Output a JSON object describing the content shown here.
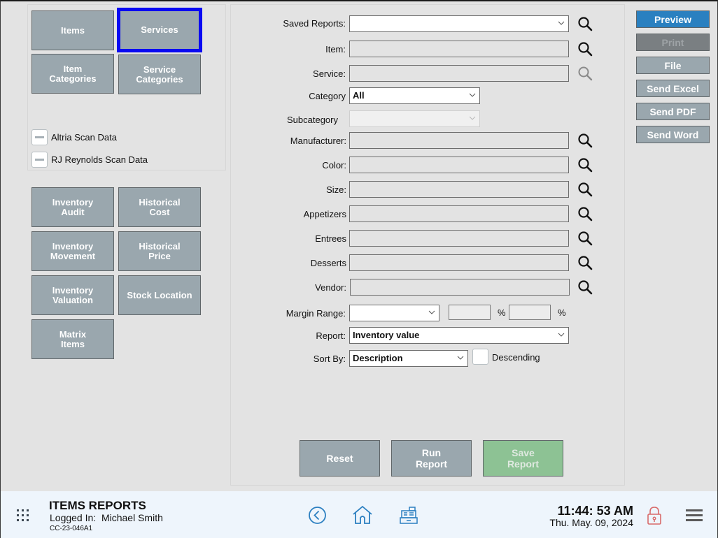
{
  "left_panel": {
    "report_types": [
      {
        "label": "Items",
        "selected": false
      },
      {
        "label": "Services",
        "selected": true
      },
      {
        "label": "Item\nCategories",
        "selected": false
      },
      {
        "label": "Service\nCategories",
        "selected": false
      }
    ],
    "scan_data": [
      {
        "label": "Altria Scan Data"
      },
      {
        "label": "RJ Reynolds Scan Data"
      }
    ],
    "other_reports": [
      {
        "label": "Inventory\nAudit"
      },
      {
        "label": "Historical\nCost"
      },
      {
        "label": "Inventory\nMovement"
      },
      {
        "label": "Historical\nPrice"
      },
      {
        "label": "Inventory\nValuation"
      },
      {
        "label": "Stock Location"
      },
      {
        "label": "Matrix\nItems"
      }
    ]
  },
  "form": {
    "saved_reports": {
      "label": "Saved Reports:",
      "value": ""
    },
    "item": {
      "label": "Item:",
      "value": ""
    },
    "service": {
      "label": "Service:",
      "value": ""
    },
    "category": {
      "label": "Category",
      "value": "All"
    },
    "subcategory": {
      "label": "Subcategory",
      "value": ""
    },
    "manufacturer": {
      "label": "Manufacturer:",
      "value": ""
    },
    "color": {
      "label": "Color:",
      "value": ""
    },
    "size": {
      "label": "Size:",
      "value": ""
    },
    "appetizers": {
      "label": "Appetizers",
      "value": ""
    },
    "entrees": {
      "label": "Entrees",
      "value": ""
    },
    "desserts": {
      "label": "Desserts",
      "value": ""
    },
    "vendor": {
      "label": "Vendor:",
      "value": ""
    },
    "margin_range": {
      "label": "Margin Range:",
      "value": "",
      "from": "",
      "to": "",
      "unit": "%"
    },
    "report": {
      "label": "Report:",
      "value": "Inventory value"
    },
    "sort_by": {
      "label": "Sort By:",
      "value": "Description",
      "descending_label": "Descending",
      "descending": false
    }
  },
  "actions": {
    "reset": "Reset",
    "run_report": "Run\nReport",
    "save_report": "Save\nReport"
  },
  "output": {
    "preview": "Preview",
    "print": "Print",
    "file": "File",
    "send_excel": "Send Excel",
    "send_pdf": "Send PDF",
    "send_word": "Send Word"
  },
  "footer": {
    "title": "ITEMS REPORTS",
    "logged_in": "Logged In:  Michael Smith",
    "station": "CC-23-046A1",
    "time": "11:44: 53 AM",
    "date": "Thu. May. 09, 2024"
  },
  "colors": {
    "selected_border": "#0a0af2",
    "primary": "#2a80c0",
    "tile": "#9aa7ae",
    "save_button": "#8dc294",
    "footer_icon": "#2b7fc0",
    "lock_icon": "#d86a6a"
  }
}
